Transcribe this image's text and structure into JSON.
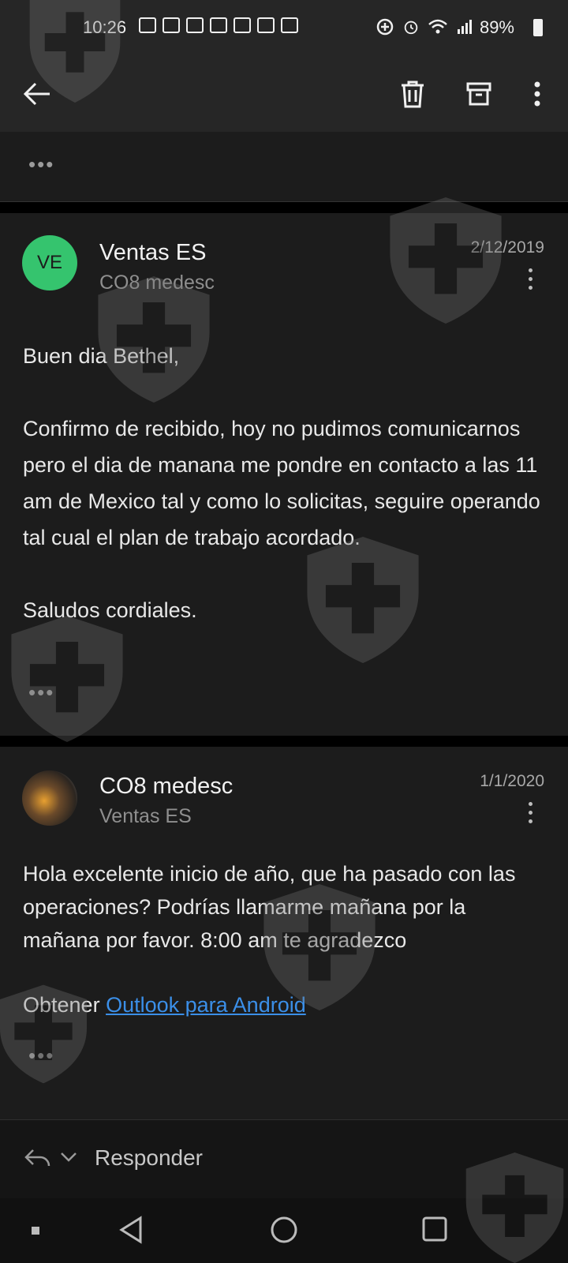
{
  "status_bar": {
    "time": "10:26",
    "battery": "89%"
  },
  "toolbar": {
    "back_icon": "back-arrow-icon",
    "delete_icon": "trash-icon",
    "archive_icon": "archive-icon",
    "more_icon": "more-vertical-icon"
  },
  "collapsed": {
    "ellipsis": "•••"
  },
  "messages": [
    {
      "avatar_initials": "VE",
      "avatar_color": "#35c46e",
      "sender": "Ventas ES",
      "recipient": "CO8 medesc",
      "date": "2/12/2019",
      "body": [
        "Buen dia Bethel,",
        "Confirmo de recibido, hoy no pudimos comunicarnos pero el dia de manana me pondre en contacto a las 11 am de Mexico tal y como lo solicitas, seguire operando tal cual el plan de trabajo acordado.",
        "Saludos cordiales."
      ],
      "ellipsis": "•••"
    },
    {
      "sender": "CO8 medesc",
      "recipient": "Ventas ES",
      "date": "1/1/2020",
      "body": [
        "Hola excelente inicio de año, que ha pasado con las operaciones? Podrías llamarme mañana por la mañana por favor. 8:00 am te agradezco"
      ],
      "signature_prefix": "Obtener ",
      "signature_link": "Outlook para Android",
      "ellipsis": "•••"
    }
  ],
  "reply": {
    "label": "Responder"
  }
}
